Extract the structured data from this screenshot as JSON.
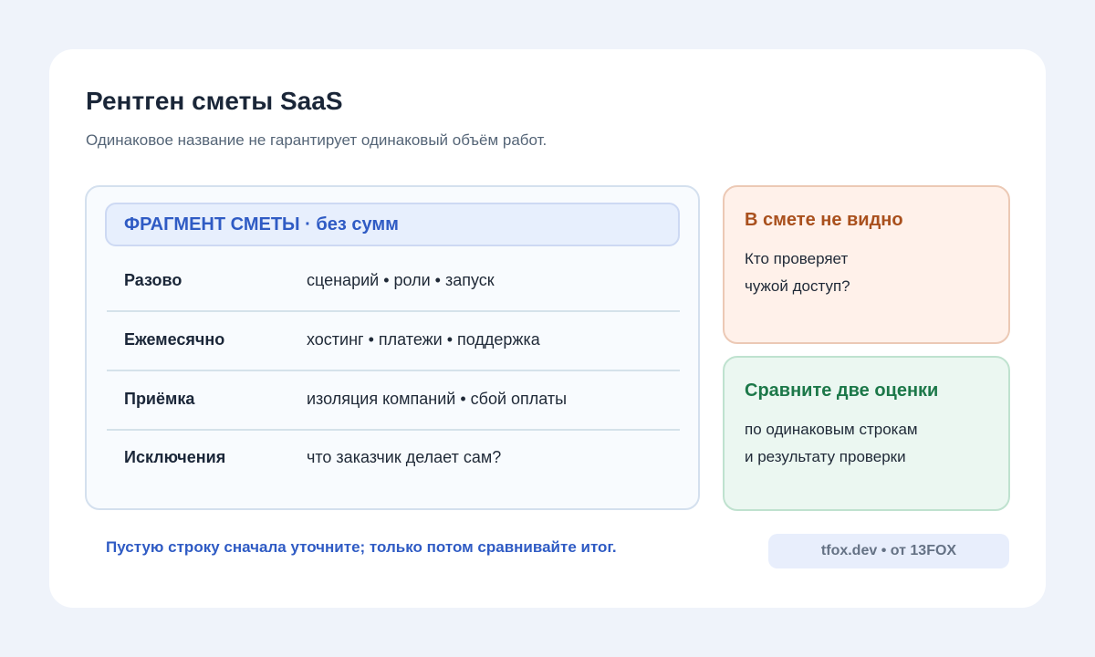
{
  "title": "Рентген сметы SaaS",
  "subtitle": "Одинаковое название не гарантирует одинаковый объём работ.",
  "estimate": {
    "header": "ФРАГМЕНТ СМЕТЫ · без сумм",
    "rows": [
      {
        "label": "Разово",
        "value": "сценарий • роли • запуск"
      },
      {
        "label": "Ежемесячно",
        "value": "хостинг • платежи • поддержка"
      },
      {
        "label": "Приёмка",
        "value": "изоляция компаний • сбой оплаты"
      },
      {
        "label": "Исключения",
        "value": "что заказчик делает сам?"
      }
    ]
  },
  "notes": {
    "warning": {
      "title": "В смете не видно",
      "lines": [
        "Кто проверяет",
        "чужой доступ?"
      ]
    },
    "compare": {
      "title": "Сравните две оценки",
      "lines": [
        "по одинаковым строкам",
        "и результату проверки"
      ]
    }
  },
  "footer": {
    "hint": "Пустую строку сначала уточните; только потом сравнивайте итог.",
    "badge": "tfox.dev • от 13FOX"
  },
  "colors": {
    "page_background": "#eff3fa",
    "accent_blue": "#2f5bc4",
    "warning_title": "#a9501d",
    "compare_title": "#1c7849"
  }
}
